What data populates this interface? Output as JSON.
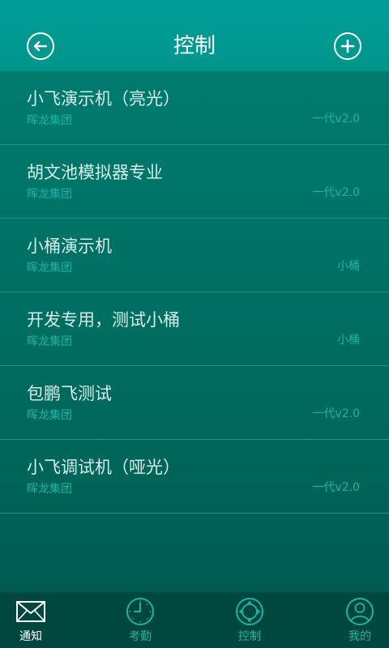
{
  "header": {
    "title": "控制",
    "back_icon": "back-arrow-icon",
    "add_icon": "plus-icon"
  },
  "devices": [
    {
      "title": "小飞演示机（亮光）",
      "company": "晖龙集团",
      "version": "一代v2.0"
    },
    {
      "title": "胡文池模拟器专业",
      "company": "晖龙集团",
      "version": "一代v2.0"
    },
    {
      "title": "小桶演示机",
      "company": "晖龙集团",
      "version": "小桶"
    },
    {
      "title": "开发专用，测试小桶",
      "company": "晖龙集团",
      "version": "小桶"
    },
    {
      "title": "包鹏飞测试",
      "company": "晖龙集团",
      "version": "一代v2.0"
    },
    {
      "title": "小飞调试机（哑光）",
      "company": "晖龙集团",
      "version": "一代v2.0"
    }
  ],
  "tabbar": {
    "tabs": [
      {
        "label": "通知",
        "icon": "mail-icon",
        "active": true
      },
      {
        "label": "考勤",
        "icon": "clock-icon",
        "active": false
      },
      {
        "label": "控制",
        "icon": "dpad-icon",
        "active": false
      },
      {
        "label": "我的",
        "icon": "user-icon",
        "active": false
      }
    ]
  },
  "colors": {
    "header": "#00958c",
    "list_background": "#006b5f",
    "accent_text": "#1fb3a4",
    "tabbar": "#00483f"
  }
}
